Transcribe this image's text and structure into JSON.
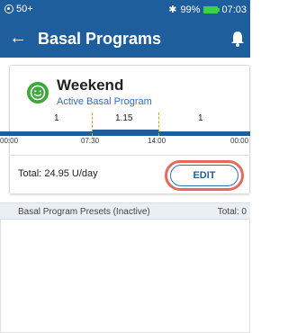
{
  "status_bar": {
    "left_text": "50+",
    "bluetooth": "✱",
    "battery_percent": "99%",
    "time": "07:03",
    "battery_color": "#3ad24a"
  },
  "app_bar": {
    "back_icon": "←",
    "title": "Basal Programs",
    "notification_icon": "bell-icon",
    "background": "#1e5e9c"
  },
  "active_program": {
    "icon": "smile-icon",
    "name": "Weekend",
    "subtitle": "Active Basal Program",
    "segments": [
      {
        "rate": "1"
      },
      {
        "rate": "1.15"
      },
      {
        "rate": "1"
      }
    ],
    "time_labels": [
      "00:00",
      "07:30",
      "14:00",
      "00:00"
    ],
    "total_label": "Total: 24.95 U/day",
    "edit_label": "EDIT"
  },
  "presets": {
    "label": "Basal Program Presets (Inactive)",
    "total": "Total: 0"
  }
}
